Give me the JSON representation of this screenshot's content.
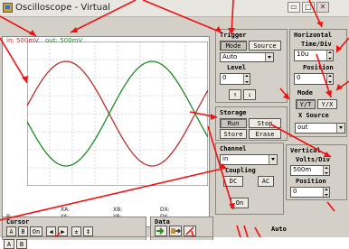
{
  "window": {
    "title": "Oscilloscope - Virtual",
    "buttons": [
      "▭",
      "□",
      "✕"
    ]
  },
  "scope": {
    "legend_in": "in: 500mV",
    "legend_out": "out: 500mV",
    "colors": {
      "in": "#b83030",
      "out": "#208a20",
      "grid": "#b8b8b8"
    }
  },
  "readout": {
    "xa": "XA:",
    "xb": "XB:",
    "dx": "DX:",
    "b": "B:",
    "ya": "YA:",
    "yb": "YB:",
    "dy": "DY:"
  },
  "trigger": {
    "title": "Trigger",
    "mode_btn": "Mode",
    "source_btn": "Source",
    "mode_value": "Auto",
    "level_label": "Level",
    "level_value": "0",
    "edge_rise": "↑",
    "edge_fall": "↓"
  },
  "horizontal": {
    "title": "Horizontal",
    "time_div_label": "Time/Div",
    "time_div_value": "10u",
    "position_label": "Position",
    "position_value": "0",
    "mode_label": "Mode",
    "yt": "Y/T",
    "yx": "Y/X",
    "xsource_label": "X Source",
    "xsource_value": "out"
  },
  "storage": {
    "title": "Storage",
    "run": "Run",
    "stop": "Stop",
    "store": "Store",
    "erase": "Erase"
  },
  "channel": {
    "title": "Channel",
    "value": "in",
    "coupling_label": "Coupling",
    "dc": "DC",
    "ac": "AC",
    "on": "On"
  },
  "vertical": {
    "title": "Vertical",
    "volts_div_label": "Volts/Div",
    "volts_div_value": "500m",
    "position_label": "Position",
    "position_value": "0",
    "auto": "Auto"
  },
  "cursor": {
    "title": "Cursor",
    "a": "A",
    "b": "B",
    "on": "On",
    "left": "◀",
    "right": "▶",
    "pm": "±",
    "updown": "‡"
  },
  "data": {
    "title": "Data"
  }
}
